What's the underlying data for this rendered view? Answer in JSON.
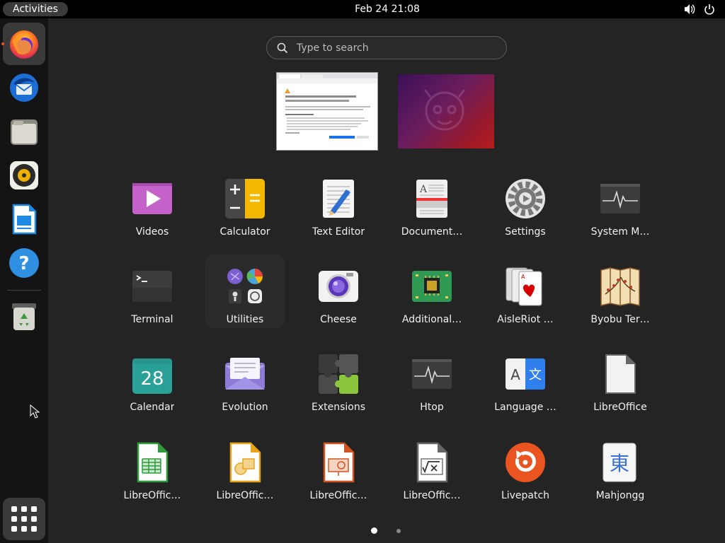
{
  "topbar": {
    "activities_label": "Activities",
    "clock": "Feb 24  21:08",
    "tray": [
      "volume-icon",
      "power-icon"
    ]
  },
  "dock": {
    "items": [
      {
        "name": "firefox",
        "icon": "firefox-icon",
        "running": true
      },
      {
        "name": "thunderbird",
        "icon": "thunderbird-icon"
      },
      {
        "name": "files",
        "icon": "files-icon"
      },
      {
        "name": "rhythmbox",
        "icon": "rhythmbox-icon"
      },
      {
        "name": "libreoffice-writer",
        "icon": "writer-icon"
      },
      {
        "name": "help",
        "icon": "help-icon"
      },
      {
        "name": "trash",
        "icon": "trash-icon"
      }
    ],
    "show_apps_icon": "app-grid-icon"
  },
  "search": {
    "placeholder": "Type to search",
    "value": ""
  },
  "workspaces": [
    {
      "name": "workspace-1",
      "content": "browser-window"
    },
    {
      "name": "workspace-2",
      "content": "wallpaper"
    }
  ],
  "apps": [
    {
      "label": "Videos",
      "icon": "videos-icon"
    },
    {
      "label": "Calculator",
      "icon": "calculator-icon"
    },
    {
      "label": "Text Editor",
      "icon": "text-editor-icon"
    },
    {
      "label": "Document…",
      "icon": "document-viewer-icon"
    },
    {
      "label": "Settings",
      "icon": "settings-icon"
    },
    {
      "label": "System M…",
      "icon": "system-monitor-icon"
    },
    {
      "label": "Terminal",
      "icon": "terminal-icon"
    },
    {
      "label": "Utilities",
      "icon": "utilities-folder-icon",
      "highlighted": true
    },
    {
      "label": "Cheese",
      "icon": "cheese-icon"
    },
    {
      "label": "Additional…",
      "icon": "additional-drivers-icon"
    },
    {
      "label": "AisleRiot …",
      "icon": "aisleriot-icon"
    },
    {
      "label": "Byobu Ter…",
      "icon": "byobu-icon"
    },
    {
      "label": "Calendar",
      "icon": "calendar-icon",
      "day": "28"
    },
    {
      "label": "Evolution",
      "icon": "evolution-icon"
    },
    {
      "label": "Extensions",
      "icon": "extensions-icon"
    },
    {
      "label": "Htop",
      "icon": "htop-icon"
    },
    {
      "label": "Language …",
      "icon": "language-icon",
      "glyphs": "A 文"
    },
    {
      "label": "LibreOffice",
      "icon": "libreoffice-icon"
    },
    {
      "label": "LibreOffic…",
      "icon": "libreoffice-calc-icon"
    },
    {
      "label": "LibreOffic…",
      "icon": "libreoffice-draw-icon"
    },
    {
      "label": "LibreOffic…",
      "icon": "libreoffice-impress-icon"
    },
    {
      "label": "LibreOffic…",
      "icon": "libreoffice-math-icon"
    },
    {
      "label": "Livepatch",
      "icon": "livepatch-icon"
    },
    {
      "label": "Mahjongg",
      "icon": "mahjongg-icon",
      "glyph": "東"
    }
  ],
  "pagination": {
    "pages": 2,
    "current": 1
  },
  "colors": {
    "accent": "#e95420",
    "background": "#242424",
    "dock": "#141414"
  }
}
